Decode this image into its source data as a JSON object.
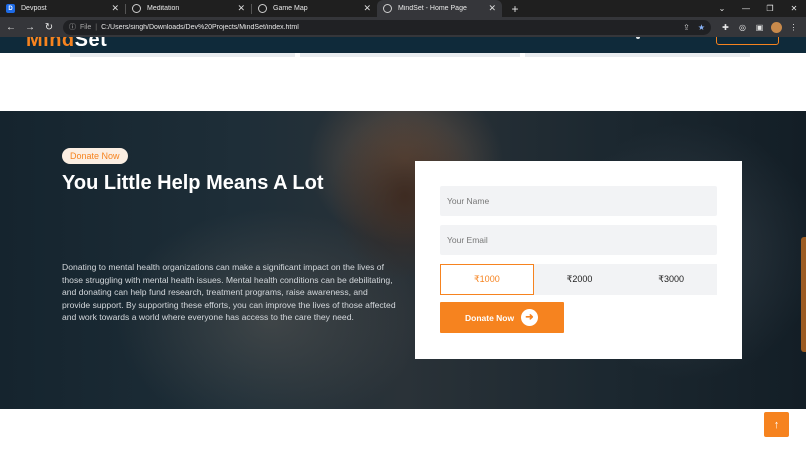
{
  "browser": {
    "tabs": [
      {
        "title": "Devpost",
        "favicon": "devpost-d-icon",
        "active": false
      },
      {
        "title": "Meditation",
        "favicon": "globe-icon",
        "active": false
      },
      {
        "title": "Game Map",
        "favicon": "globe-icon",
        "active": false
      },
      {
        "title": "MindSet - Home Page",
        "favicon": "globe-icon",
        "active": true
      }
    ],
    "close_glyph": "✕",
    "new_tab": "+",
    "address": {
      "scheme": "File",
      "url": "C:/Users/singh/Downloads/Dev%20Projects/MindSet/index.html"
    }
  },
  "site": {
    "logo_accent": "Mind",
    "logo_rest": "Set"
  },
  "donate": {
    "tag": "Donate Now",
    "headline": "You Little Help Means A Lot",
    "body": "Donating to mental health organizations can make a significant impact on the lives of those struggling with mental health issues. Mental health conditions can be debilitating, and donating can help fund research, treatment programs, raise awareness, and provide support. By supporting these efforts, you can improve the lives of those affected and work towards a world where everyone has access to the care they need.",
    "form": {
      "name_placeholder": "Your Name",
      "email_placeholder": "Your Email",
      "amounts": [
        "₹1000",
        "₹2000",
        "₹3000"
      ],
      "selected_amount": "₹1000",
      "submit_label": "Donate Now"
    }
  },
  "colors": {
    "accent": "#f6831f",
    "header_bg": "#0f2a3a",
    "card_bg": "#ffffff"
  }
}
